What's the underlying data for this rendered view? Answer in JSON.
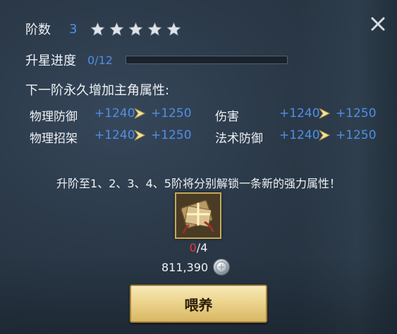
{
  "header": {
    "rank_label": "阶数",
    "rank_value": "3",
    "stars_total": 5,
    "stars_filled": 5
  },
  "progress": {
    "label": "升星进度",
    "text": "0/12",
    "fraction": 0.0
  },
  "next_rank": {
    "title": "下一阶永久增加主角属性:",
    "attributes": [
      {
        "name": "物理防御",
        "current": "+1240",
        "next": "+1250"
      },
      {
        "name": "伤害",
        "current": "+1240",
        "next": "+1250"
      },
      {
        "name": "物理招架",
        "current": "+1240",
        "next": "+1250"
      },
      {
        "name": "法术防御",
        "current": "+1240",
        "next": "+1250"
      }
    ]
  },
  "hint": "升阶至1、2、3、4、5阶将分别解锁一条新的强力属性！",
  "item": {
    "icon": "scroll-bundle-icon",
    "owned": "0",
    "required": "/4"
  },
  "cost": {
    "amount": "811,390",
    "currency_icon": "silver-coin-icon"
  },
  "buttons": {
    "feed_label": "喂养",
    "close_icon": "close-icon"
  },
  "colors": {
    "accent_blue": "#4f8fe6",
    "warning_red": "#e23b3b",
    "button_gold": "#ecd48e"
  }
}
